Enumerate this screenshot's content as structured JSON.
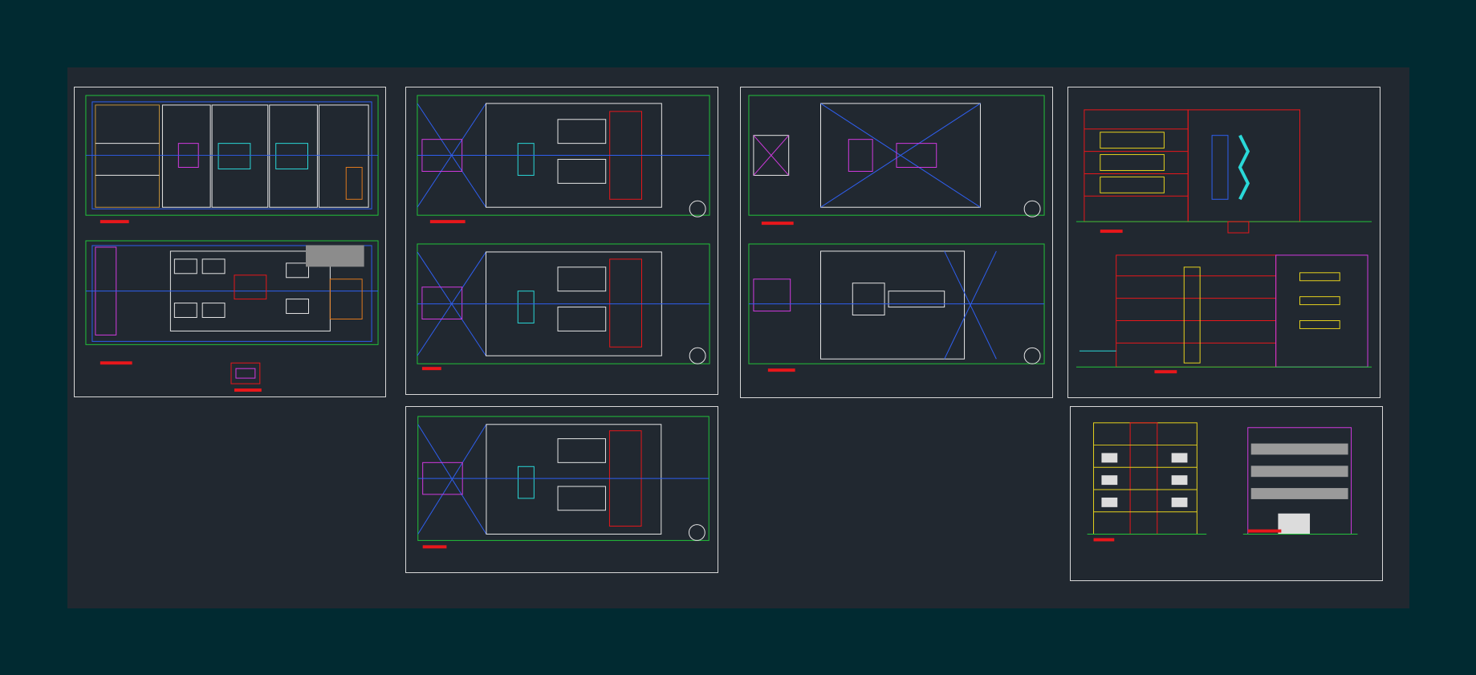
{
  "drawing": {
    "background_color": "#012a31",
    "model_space_color": "#212830",
    "line_colors": {
      "grid_green": "#22c33a",
      "axis_blue": "#2f5ff0",
      "wall_white": "#e6e6e6",
      "structure_red": "#e8171b",
      "furniture_magenta": "#d23ae0",
      "accent_cyan": "#2ad8d8",
      "text_yellow": "#e6d21e",
      "door_orange": "#e07a1e"
    },
    "sheets": [
      {
        "id": "plans-ground-and-parking",
        "kind": "plan",
        "views": 2
      },
      {
        "id": "plans-typical-floors-a",
        "kind": "plan",
        "views": 2
      },
      {
        "id": "plans-roof-and-penthouse",
        "kind": "plan",
        "views": 2
      },
      {
        "id": "sections",
        "kind": "section",
        "views": 2
      },
      {
        "id": "plans-typical-floors-b",
        "kind": "plan",
        "views": 1
      },
      {
        "id": "elevations",
        "kind": "elevation",
        "views": 2
      }
    ]
  }
}
